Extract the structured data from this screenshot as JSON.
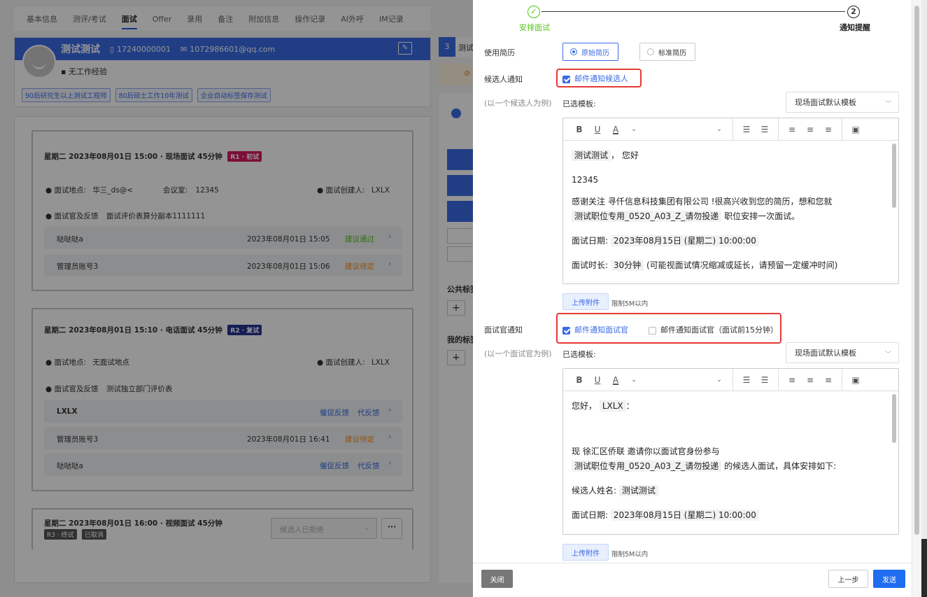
{
  "tabs": [
    {
      "label": "基本信息"
    },
    {
      "label": "测评/考试"
    },
    {
      "label": "面试",
      "active": true
    },
    {
      "label": "Offer"
    },
    {
      "label": "录用"
    },
    {
      "label": "备注"
    },
    {
      "label": "附加信息"
    },
    {
      "label": "操作记录"
    },
    {
      "label": "AI外呼"
    },
    {
      "label": "IM记录"
    }
  ],
  "candidate": {
    "name": "测试测试",
    "phone": "17240000001",
    "email": "1072986601@qq.com",
    "experience": "无工作经验",
    "tags": [
      "90后研究生以上测试工程师",
      "80后硕士工作10年测试",
      "企业自动标签保存测试"
    ]
  },
  "side": {
    "count": "3",
    "count_text": "测试",
    "public_tags": "公共标签",
    "my_tags": "我的标签",
    "plus": "+"
  },
  "interviews": [
    {
      "header": "星期二  2023年08月01日 15:00 · 现场面试  45分钟",
      "badge": "R1 · 初试",
      "location_label": "面试地点:",
      "location": "华三_ds@<",
      "room_label": "会议室:",
      "room": "12345",
      "creator_label": "面试创建人:",
      "creator": "LXLX",
      "feedback_label": "面试官及反馈",
      "feedback_form": "面试评价表算分副本1111111",
      "rows": [
        {
          "name": "哒哒哒a",
          "time": "2023年08月01日 15:05",
          "status": "建议通过"
        },
        {
          "name": "管理员账号3",
          "time": "2023年08月01日 15:06",
          "status": "建议待定"
        }
      ]
    },
    {
      "header": "星期二  2023年08月01日 15:10 · 电话面试  45分钟",
      "badge": "R2 · 复试",
      "location_label": "面试地点:",
      "location": "无面试地点",
      "creator_label": "面试创建人:",
      "creator": "LXLX",
      "feedback_label": "面试官及反馈",
      "feedback_form": "测试独立部门评价表",
      "rows": [
        {
          "name": "LXLX",
          "link1": "催促反馈",
          "link2": "代反馈"
        },
        {
          "name": "管理员账号3",
          "time": "2023年08月01日 16:41",
          "status": "建议待定"
        },
        {
          "name": "哒哒哒a",
          "link1": "催促反馈",
          "link2": "代反馈"
        }
      ]
    },
    {
      "header": "星期二  2023年08月01日 16:00 · 视频面试  45分钟",
      "badge1": "R3 · 终试",
      "badge2": "已取消",
      "status_select": "候选人已拒绝",
      "more": "···"
    }
  ],
  "drawer": {
    "steps": [
      {
        "label": "安排面试",
        "done": true
      },
      {
        "label": "通知提醒",
        "num": "2"
      }
    ],
    "resume_label": "使用简历",
    "resume_options": [
      "原始简历",
      "标准简历"
    ],
    "candidate_notice_label": "候选人通知",
    "candidate_example": "(以一个候选人为例)",
    "candidate_checkbox": "邮件通知候选人",
    "template_label": "已选模板:",
    "template_value": "现场面试默认模板",
    "candidate_mail": {
      "greeting_name": "测试测试",
      "greeting_suffix": "，  您好",
      "line2": "12345",
      "line3a": "感谢关注 寻仟信息科技集团有限公司 !很高兴收到您的简历，想和您就",
      "job": "测试职位专用_0520_A03_Z_请勿投递",
      "line3b": "职位安排一次面试。",
      "date_label": "面试日期:",
      "date_value": "2023年08月15日 (星期二) 10:00:00",
      "dur_label": "面试时长:",
      "dur_value": "30分钟",
      "dur_note": "(可能视面试情况缩减或延长，请预留一定缓冲时间)"
    },
    "upload_label": "上传附件",
    "upload_limit": "限制5M以内",
    "interviewer_notice_label": "面试官通知",
    "interviewer_example": "(以一个面试官为例)",
    "interviewer_checkbox1": "邮件通知面试官",
    "interviewer_checkbox2": "邮件通知面试官（面试前15分钟）",
    "interviewer_mail": {
      "hello": "您好，",
      "name": "LXLX",
      "colon": "：",
      "line_a": "现 徐汇区侨联 邀请你以面试官身份参与",
      "job": "测试职位专用_0520_A03_Z_请勿投递",
      "line_b": "的候选人面试，具体安排如下:",
      "cand_label": "候选人姓名:",
      "cand_value": "测试测试",
      "date_label": "面试日期:",
      "date_value": "2023年08月15日 (星期二) 10:00:00"
    },
    "close_btn": "关闭",
    "prev_btn": "上一步",
    "send_btn": "发送"
  },
  "colors": {
    "primary": "#3a6be6",
    "highlight": "#e53935",
    "success": "#52c41a",
    "warning": "#fa8c16"
  }
}
